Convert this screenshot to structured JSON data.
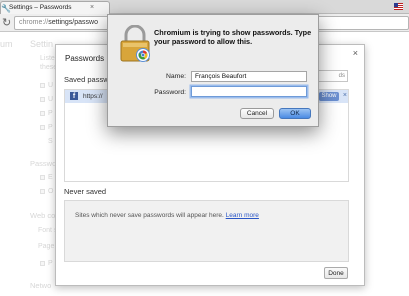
{
  "browser": {
    "tab_title": "Settings – Passwords",
    "tab_close": "×",
    "url_scheme": "chrome://",
    "url_path": "settings/passwo"
  },
  "settings_bg": {
    "logo_fragment": "um",
    "heading": "Settin",
    "lines": [
      "Listen",
      "these"
    ],
    "check_labels": [
      "U",
      "U",
      "P",
      "P",
      "S"
    ],
    "sec_passwords": "Passwo",
    "pw_checks": [
      "E",
      "O"
    ],
    "sec_web": "Web co",
    "web_lines": [
      "Font s",
      "Page z"
    ],
    "web_check": "P",
    "sec_network": "Netwo"
  },
  "passwords_card": {
    "title": "Passwords",
    "close_label": "×",
    "saved_label": "Saved passw",
    "search_fragment": "ds",
    "row_url": "https://",
    "row_icon_letter": "f",
    "show_label": "Show",
    "remove_label": "×",
    "never_saved_label": "Never saved",
    "never_note": "Sites which never save passwords will appear here.",
    "learn_more": "Learn more",
    "done_label": "Done"
  },
  "auth_dialog": {
    "message": "Chromium is trying to show passwords. Type your password to allow this.",
    "name_label": "Name:",
    "name_value": "François Beaufort",
    "password_label": "Password:",
    "password_value": "",
    "cancel_label": "Cancel",
    "ok_label": "OK"
  }
}
